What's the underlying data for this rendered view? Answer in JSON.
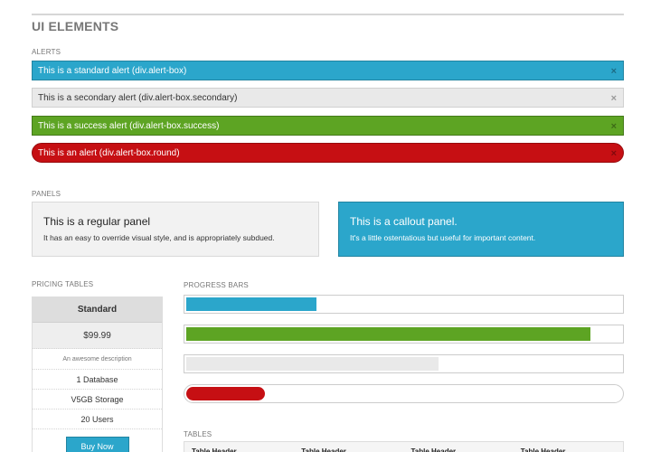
{
  "page": {
    "title": "UI ELEMENTS"
  },
  "alerts": {
    "label": "ALERTS",
    "close_glyph": "×",
    "items": [
      {
        "text": "This is a standard alert (div.alert-box)",
        "color": "#2ba6cb"
      },
      {
        "text": "This is a secondary alert (div.alert-box.secondary)",
        "color": "#e9e9e9"
      },
      {
        "text": "This is a success alert (div.alert-box.success)",
        "color": "#5da423"
      },
      {
        "text": "This is an alert (div.alert-box.round)",
        "color": "#c60f13"
      }
    ]
  },
  "panels": {
    "label": "PANELS",
    "regular": {
      "title": "This is a regular panel",
      "body": "It has an easy to override visual style, and is appropriately subdued."
    },
    "callout": {
      "title": "This is a callout panel.",
      "body": "It's a little ostentatious but useful for important content."
    }
  },
  "pricing": {
    "label": "PRICING TABLES",
    "title": "Standard",
    "price": "$99.99",
    "description": "An awesome description",
    "bullets": [
      "1 Database",
      "V5GB Storage",
      "20 Users"
    ],
    "cta": "Buy Now"
  },
  "progress": {
    "label": "PROGRESS BARS",
    "bars": [
      {
        "percent": 30,
        "color": "#2ba6cb"
      },
      {
        "percent": 93,
        "color": "#5da423"
      },
      {
        "percent": 58,
        "color": "#e9e9e9"
      },
      {
        "percent": 18,
        "color": "#c60f13"
      }
    ]
  },
  "tables": {
    "label": "TABLES",
    "headers": [
      "Table Header",
      "Table Header",
      "Table Header",
      "Table Header"
    ]
  }
}
